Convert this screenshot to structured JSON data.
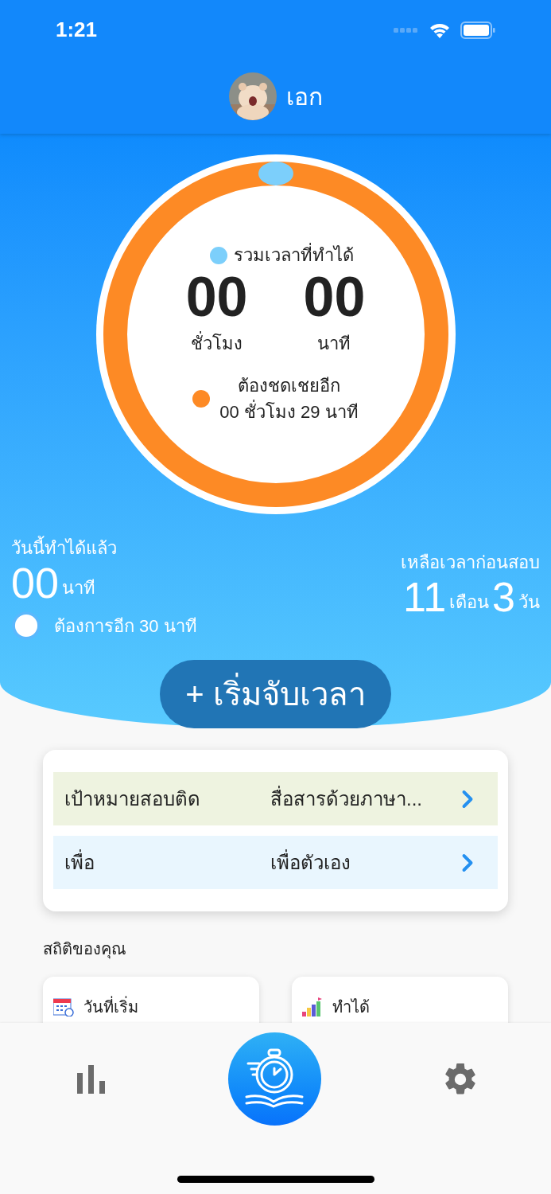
{
  "status_bar": {
    "time": "1:21"
  },
  "header": {
    "name": "เอก"
  },
  "timer": {
    "label": "รวมเวลาที่ทำได้",
    "hours": "00",
    "hours_unit": "ชั่วโมง",
    "minutes": "00",
    "minutes_unit": "นาที",
    "remaining_label": "ต้องชดเชยอีก",
    "remaining": "00 ชั่วโมง 29 นาที",
    "level": 0
  },
  "today": {
    "title": "วันนี้ทำได้แล้ว",
    "value": "00",
    "unit": "นาที",
    "need": "ต้องการอีก 30 นาที"
  },
  "countdown": {
    "title": "เหลือเวลาก่อนสอบ",
    "months": "11",
    "months_unit": "เดือน",
    "days": "3",
    "days_unit": "วัน"
  },
  "start_button": "+ เริ่มจับเวลา",
  "goals": [
    {
      "label": "เป้าหมายสอบติด",
      "value": "สื่อสารด้วยภาษา...",
      "color": "#eef3e0"
    },
    {
      "label": "เพื่อ",
      "value": "เพื่อตัวเอง",
      "color": "#e9f6fe"
    }
  ],
  "stats": {
    "title": "สถิติของคุณ",
    "cards": [
      {
        "kind": "calendar",
        "label": "วันที่เริ่ม"
      },
      {
        "kind": "chart",
        "label": "ทำได้"
      }
    ]
  },
  "bottom_nav": [
    {
      "kind": "stats"
    },
    {
      "kind": "timer"
    },
    {
      "kind": "settings"
    }
  ]
}
